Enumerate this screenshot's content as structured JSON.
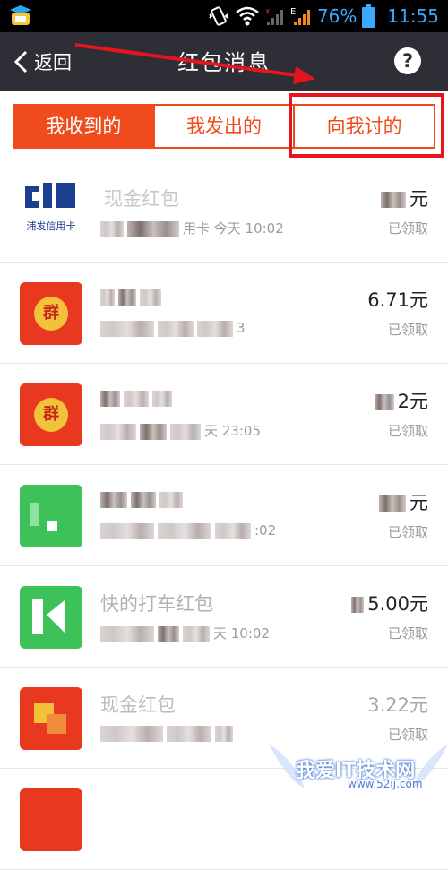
{
  "status_bar": {
    "battery_percent": "76%",
    "time": "11:55",
    "network_label": "E"
  },
  "header": {
    "back_label": "返回",
    "title": "红包消息",
    "help_label": "?"
  },
  "tabs": [
    {
      "label": "我收到的",
      "selected": true
    },
    {
      "label": "我发出的",
      "selected": false
    },
    {
      "label": "向我讨的",
      "selected": false
    }
  ],
  "items": [
    {
      "title": "现金红包",
      "subtitle_visible": "用卡 今天 10:02",
      "amount_visible": "元",
      "status": "已领取",
      "thumb_text": "浦发信用卡"
    },
    {
      "title": "",
      "subtitle_visible": "3",
      "amount_visible": "6.71元",
      "status": "已领取",
      "thumb_text": "群"
    },
    {
      "title": "",
      "subtitle_visible": "天 23:05",
      "amount_visible": "2元",
      "status": "已领取",
      "thumb_text": "群"
    },
    {
      "title": "",
      "subtitle_visible": ":02",
      "amount_visible": "元",
      "status": "已领取",
      "thumb_text": ""
    },
    {
      "title": "快的打车红包",
      "subtitle_visible": "天 10:02",
      "amount_visible": "5.00元",
      "status": "已领取",
      "thumb_text": ""
    },
    {
      "title": "现金红包",
      "subtitle_visible": "",
      "amount_visible": "3.22元",
      "status": "已领取",
      "thumb_text": ""
    }
  ],
  "watermark": {
    "text": "我爱IT技术网",
    "url": "www.52ij.com"
  },
  "colors": {
    "accent": "#f04b1c",
    "header_bg": "#2d2e36",
    "annotation_red": "#e8141d"
  }
}
